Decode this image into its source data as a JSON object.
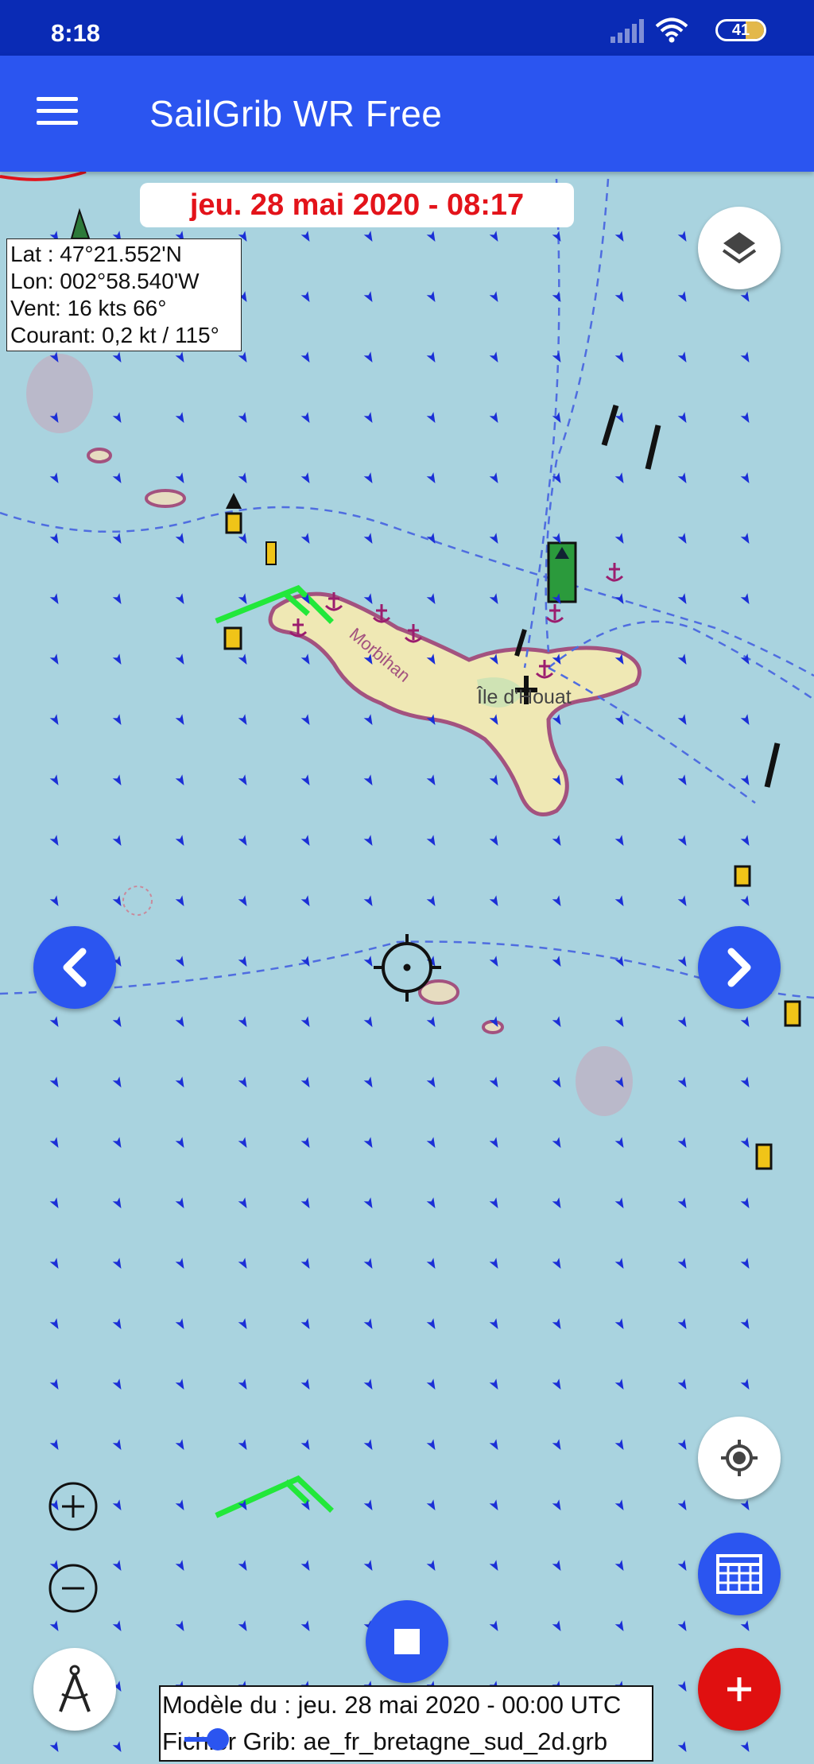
{
  "status_bar": {
    "time": "8:18",
    "battery": "41",
    "icons": [
      "signal-icon",
      "wifi-icon",
      "battery-icon"
    ]
  },
  "app_bar": {
    "title": "SailGrib WR Free",
    "menu_icon": "menu-icon"
  },
  "map": {
    "date_banner": "jeu. 28 mai 2020 - 08:17",
    "info": {
      "lat": "Lat :  47°21.552'N",
      "lon": "Lon: 002°58.540'W",
      "wind": "Vent:  16 kts  66°",
      "current": "Courant: 0,2 kt / 115°"
    },
    "labels": {
      "island": "Île d'Houat",
      "region": "Morbihan"
    },
    "colors": {
      "sea": "#a9d3df",
      "land": "#efe8b4",
      "current_arrow": "#1b2fd6",
      "wind_barb": "#22e83a",
      "anchor": "#9b1d6e"
    }
  },
  "controls": {
    "layers_button": "layers-icon",
    "prev_button": "chevron-left-icon",
    "next_button": "chevron-right-icon",
    "zoom_in": "zoom-in-icon",
    "zoom_out": "zoom-out-icon",
    "compass_button": "compass-divider-icon",
    "stop_button": "stop-icon",
    "locate_button": "locate-icon",
    "grid_button": "grid-icon",
    "add_button": "plus-icon"
  },
  "bottom_info": {
    "model": "Modèle du : jeu. 28 mai 2020 - 00:00 UTC",
    "file": "Fichier Grib: ae_fr_bretagne_sud_2d.grb",
    "timeline_position": 0.08
  }
}
